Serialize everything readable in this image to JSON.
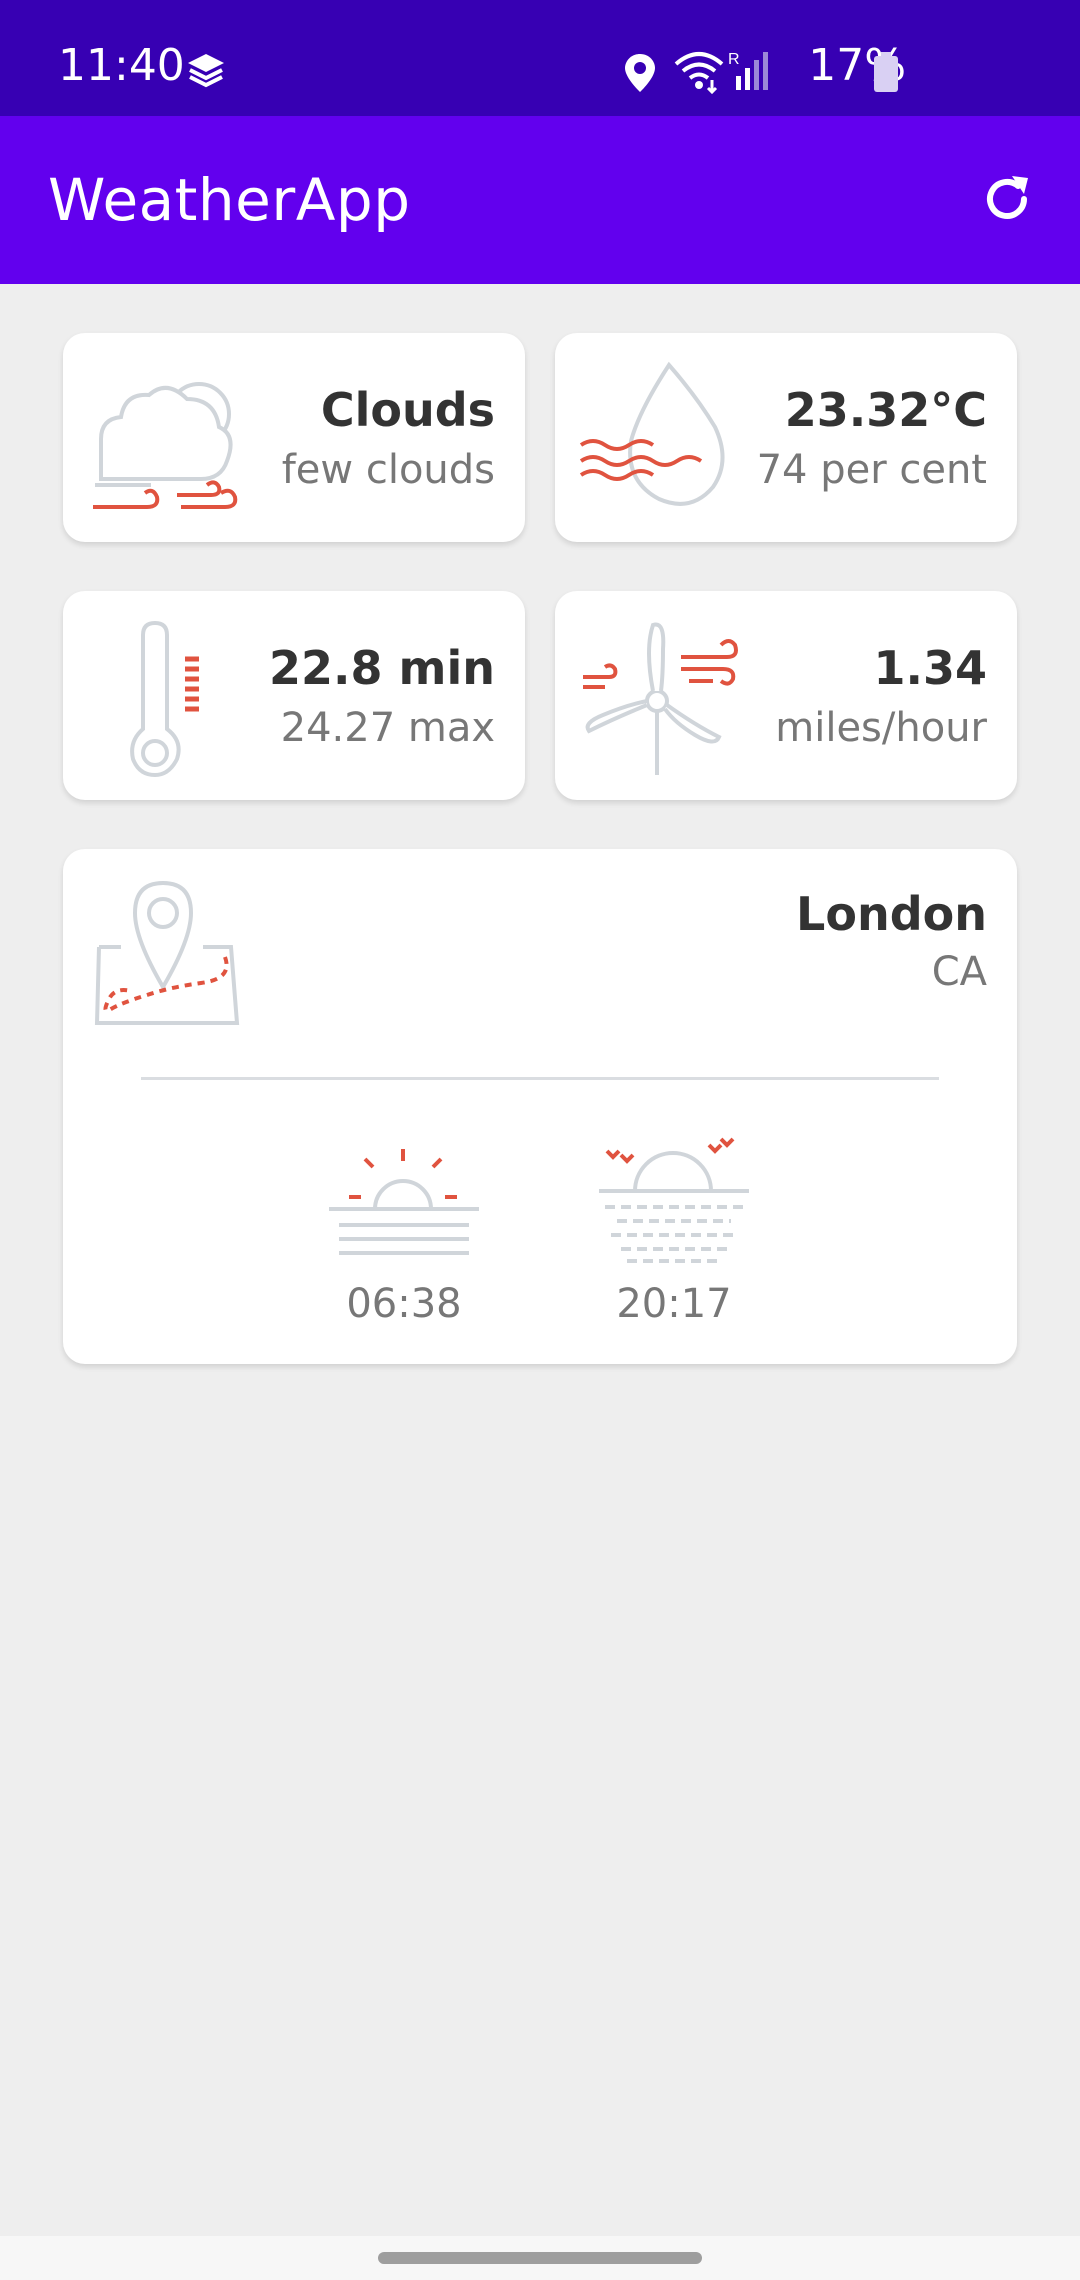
{
  "status_bar": {
    "time": "11:40",
    "battery": "17%"
  },
  "app_bar": {
    "title": "WeatherApp"
  },
  "cards": {
    "condition": {
      "main": "Clouds",
      "description": "few clouds"
    },
    "temp_humidity": {
      "temperature": "23.32°C",
      "humidity": "74 per cent"
    },
    "minmax": {
      "min": "22.8 min",
      "max": "24.27 max"
    },
    "wind": {
      "speed": "1.34",
      "unit": "miles/hour"
    },
    "location": {
      "city": "London",
      "country": "CA",
      "sunrise": "06:38",
      "sunset": "20:17"
    }
  },
  "colors": {
    "status_bar": "#3700b3",
    "app_bar": "#6200ee",
    "icon_grey": "#d0d5da",
    "icon_red": "#e0533f"
  }
}
